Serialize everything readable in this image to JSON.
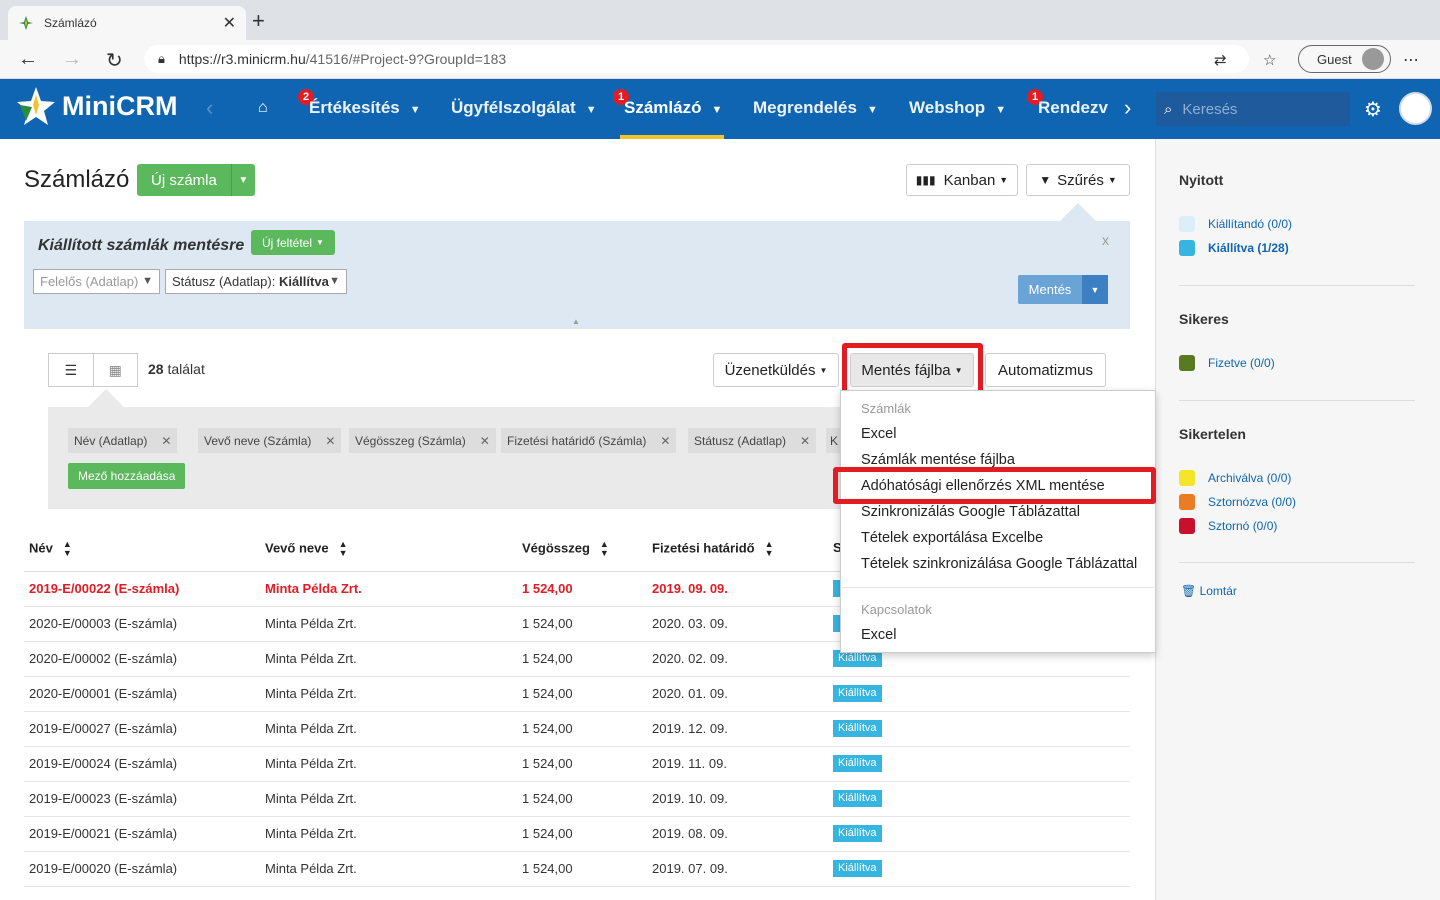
{
  "browser": {
    "tab_title": "Számlázó",
    "url_host": "https://r3.minicrm.hu",
    "url_path": "/41516/#Project-9?GroupId=183",
    "guest_label": "Guest"
  },
  "app": {
    "logo_text": "MiniCRM",
    "nav": [
      {
        "label": "Értékesítés",
        "badge": "2"
      },
      {
        "label": "Ügyfélszolgálat",
        "badge": ""
      },
      {
        "label": "Számlázó",
        "badge": "1"
      },
      {
        "label": "Megrendelés",
        "badge": ""
      },
      {
        "label": "Webshop",
        "badge": ""
      },
      {
        "label": "Rendezvé",
        "badge": "1"
      }
    ],
    "search_placeholder": "Keresés"
  },
  "page": {
    "title": "Számlázó",
    "new_invoice_label": "Új számla",
    "kanban_label": "Kanban",
    "filter_label": "Szűrés"
  },
  "filter": {
    "title": "Kiállított számlák mentésre",
    "new_condition_label": "Új feltétel",
    "owner_select": "Felelős (Adatlap)",
    "status_select_label": "Státusz (Adatlap):",
    "status_select_value": "Kiállítva",
    "close_label": "x",
    "save_label": "Mentés"
  },
  "toolbar": {
    "result_count": "28",
    "result_suffix": "találat",
    "message_label": "Üzenetküldés",
    "save_file_label": "Mentés fájlba",
    "automation_label": "Automatizmus"
  },
  "fields": {
    "chips": [
      "Név (Adatlap)",
      "Vevő neve (Számla)",
      "Végösszeg (Számla)",
      "Fizetési határidő (Számla)",
      "Státusz (Adatlap)",
      "K"
    ],
    "add_label": "Mező hozzáadása"
  },
  "dropdown": {
    "section1": "Számlák",
    "items1": [
      "Excel",
      "Számlák mentése fájlba",
      "Adóhatósági ellenőrzés XML mentése",
      "Szinkronizálás Google Táblázattal",
      "Tételek exportálása Excelbe",
      "Tételek szinkronizálása Google Táblázattal"
    ],
    "section2": "Kapcsolatok",
    "items2": [
      "Excel"
    ]
  },
  "table": {
    "headers": [
      "Név",
      "Vevő neve",
      "Végösszeg",
      "Fizetési határidő",
      "S"
    ],
    "rows": [
      {
        "name": "2019-E/00022 (E-számla)",
        "buyer": "Minta Példa Zrt.",
        "total": "1 524,00",
        "due": "2019. 09. 09.",
        "status": ""
      },
      {
        "name": "2020-E/00003 (E-számla)",
        "buyer": "Minta Példa Zrt.",
        "total": "1 524,00",
        "due": "2020. 03. 09.",
        "status": ""
      },
      {
        "name": "2020-E/00002 (E-számla)",
        "buyer": "Minta Példa Zrt.",
        "total": "1 524,00",
        "due": "2020. 02. 09.",
        "status": "Kiállítva"
      },
      {
        "name": "2020-E/00001 (E-számla)",
        "buyer": "Minta Példa Zrt.",
        "total": "1 524,00",
        "due": "2020. 01. 09.",
        "status": "Kiállítva"
      },
      {
        "name": "2019-E/00027 (E-számla)",
        "buyer": "Minta Példa Zrt.",
        "total": "1 524,00",
        "due": "2019. 12. 09.",
        "status": "Kiállítva"
      },
      {
        "name": "2019-E/00024 (E-számla)",
        "buyer": "Minta Példa Zrt.",
        "total": "1 524,00",
        "due": "2019. 11. 09.",
        "status": "Kiállítva"
      },
      {
        "name": "2019-E/00023 (E-számla)",
        "buyer": "Minta Példa Zrt.",
        "total": "1 524,00",
        "due": "2019. 10. 09.",
        "status": "Kiállítva"
      },
      {
        "name": "2019-E/00021 (E-számla)",
        "buyer": "Minta Példa Zrt.",
        "total": "1 524,00",
        "due": "2019. 08. 09.",
        "status": "Kiállítva"
      },
      {
        "name": "2019-E/00020 (E-számla)",
        "buyer": "Minta Példa Zrt.",
        "total": "1 524,00",
        "due": "2019. 07. 09.",
        "status": "Kiállítva"
      }
    ]
  },
  "sidebar": {
    "open_title": "Nyitott",
    "open_items": [
      {
        "label": "Kiállítandó (0/0)",
        "color": "#dbeefa"
      },
      {
        "label": "Kiállítva (1/28)",
        "color": "#36b5e0"
      }
    ],
    "success_title": "Sikeres",
    "success_items": [
      {
        "label": "Fizetve (0/0)",
        "color": "#5a7a22"
      }
    ],
    "fail_title": "Sikertelen",
    "fail_items": [
      {
        "label": "Archiválva (0/0)",
        "color": "#f5e52a"
      },
      {
        "label": "Sztornózva (0/0)",
        "color": "#ea7d24"
      },
      {
        "label": "Sztornó (0/0)",
        "color": "#c8102e"
      }
    ],
    "trash_label": "Lomtár"
  },
  "colors": {
    "brand_blue": "#0f65b1",
    "green": "#5cb85c",
    "highlight_red": "#e31b23"
  }
}
